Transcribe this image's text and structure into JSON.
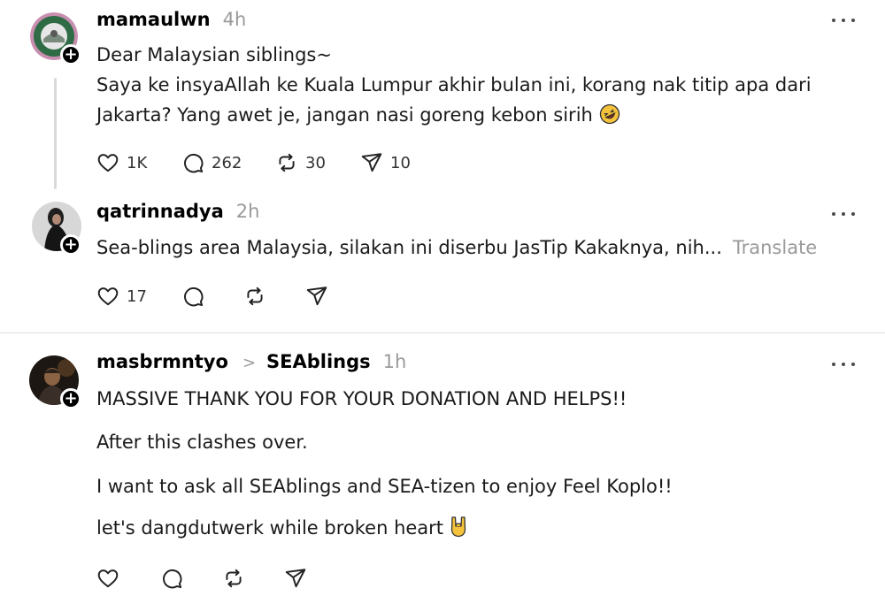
{
  "posts": [
    {
      "username": "mamaulwn",
      "time": "4h",
      "lines": [
        "Dear Malaysian siblings~",
        "Saya ke insyaAllah ke Kuala Lumpur akhir bulan ini, korang nak titip apa dari",
        "Jakarta? Yang awet je, jangan nasi goreng kebon sirih"
      ],
      "emoji": "rolling-on-floor-laughing-emoji",
      "likes": "1K",
      "comments": "262",
      "reposts": "30",
      "shares": "10"
    },
    {
      "username": "qatrinnadya",
      "time": "2h",
      "text": "Sea-blings area Malaysia, silakan ini diserbu JasTip Kakaknya, nih...",
      "translate": "Translate",
      "likes": "17"
    },
    {
      "username": "masbrmntyo",
      "topic": "SEAblings",
      "time": "1h",
      "paragraphs": [
        "MASSIVE THANK YOU FOR YOUR DONATION AND HELPS!!",
        "After this clashes over.",
        "I want to ask all SEAblings and SEA-tizen to enjoy Feel Koplo!!",
        "let's dangdutwerk while broken heart"
      ],
      "emoji": "sign-of-the-horns-emoji"
    }
  ],
  "icons": {
    "like": "heart-icon",
    "comment": "comment-icon",
    "repost": "repost-icon",
    "share": "send-icon",
    "more": "more-icon",
    "follow": "plus-icon",
    "chevron": "chevron-right-icon"
  },
  "colors": {
    "text": "#000000",
    "muted": "#9a9a9a",
    "divider": "#dedede",
    "thread_line": "#d9d9d9",
    "emoji": "#f5c33b"
  }
}
